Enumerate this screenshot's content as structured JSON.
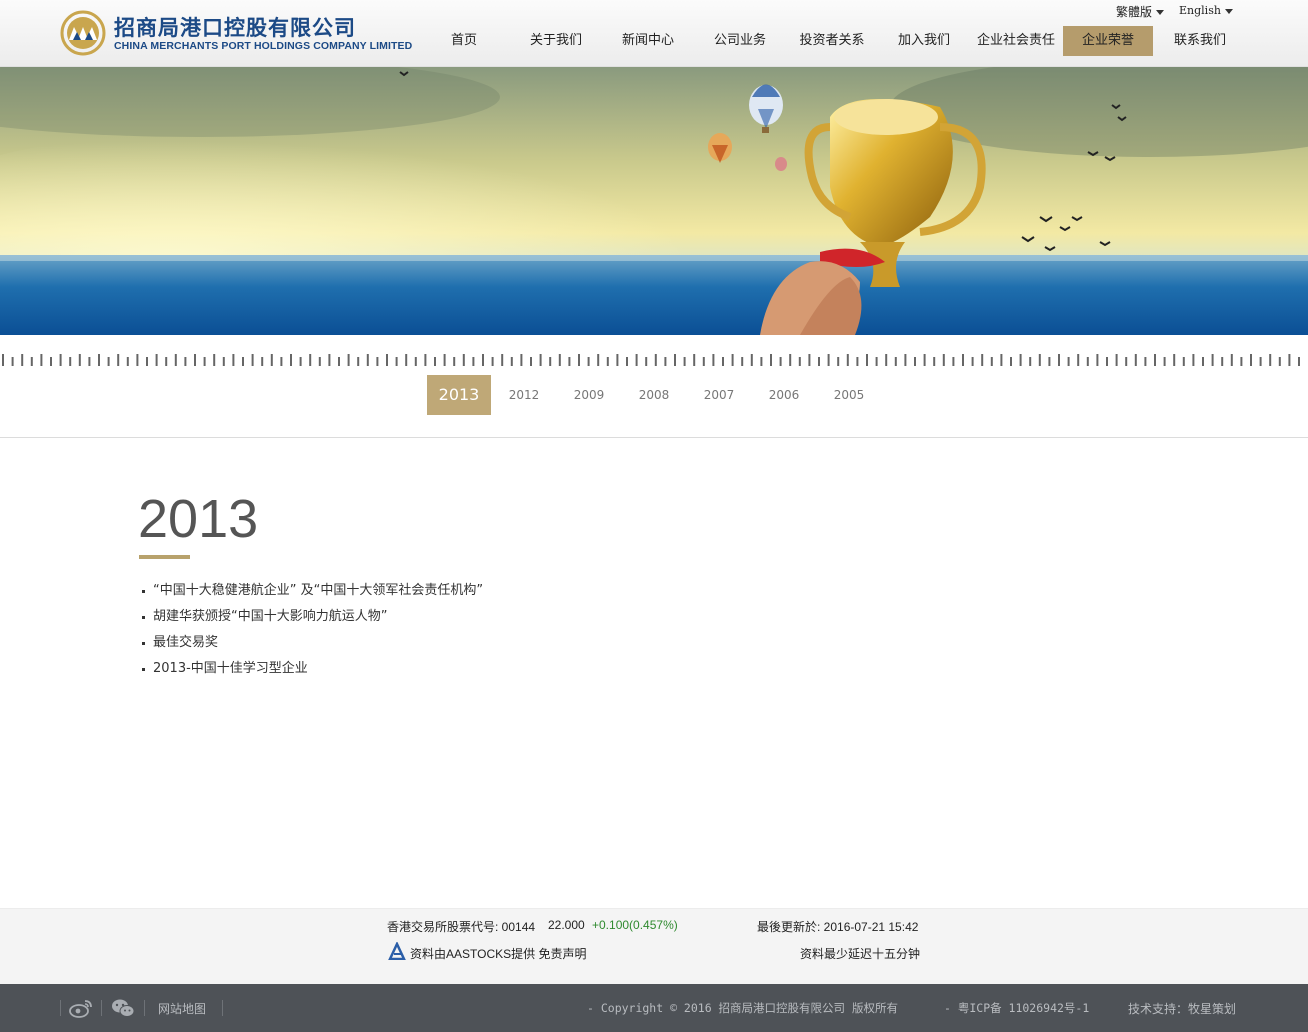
{
  "header": {
    "logo_cn": "招商局港口控股有限公司",
    "logo_en": "CHINA MERCHANTS PORT HOLDINGS COMPANY LIMITED",
    "lang_traditional": "繁體版",
    "lang_english": "English",
    "nav": [
      {
        "label": "首页"
      },
      {
        "label": "关于我们"
      },
      {
        "label": "新闻中心"
      },
      {
        "label": "公司业务"
      },
      {
        "label": "投资者关系"
      },
      {
        "label": "加入我们"
      },
      {
        "label": "企业社会责任"
      },
      {
        "label": "企业荣誉",
        "active": true
      },
      {
        "label": "联系我们"
      }
    ]
  },
  "timeline": {
    "years": [
      "2013",
      "2012",
      "2009",
      "2008",
      "2007",
      "2006",
      "2005"
    ],
    "active": "2013"
  },
  "content": {
    "year": "2013",
    "honors": [
      "“中国十大稳健港航企业” 及“中国十大领军社会责任机构”",
      "胡建华获颁授“中国十大影响力航运人物”",
      "最佳交易奖",
      "2013-中国十佳学习型企业"
    ]
  },
  "stock": {
    "code_label": "香港交易所股票代号: 00144",
    "price": "22.000",
    "change": "+0.100(0.457%)",
    "updated": "最後更新於: 2016-07-21 15:42",
    "provider": "资料由AASTOCKS提供 免责声明",
    "delay": "资料最少延迟十五分钟"
  },
  "footer": {
    "sitemap": "网站地图",
    "copyright": "- Copyright © 2016 招商局港口控股有限公司 版权所有",
    "icp": "- 粤ICP备 11026942号-1",
    "tech": "技术支持：牧星策划"
  },
  "colors": {
    "accent": "#b59c6c",
    "year_active": "#bfa877",
    "brand_blue": "#1c4a86",
    "footer_bg": "#4e5257",
    "stock_up": "#2f8a2f"
  }
}
